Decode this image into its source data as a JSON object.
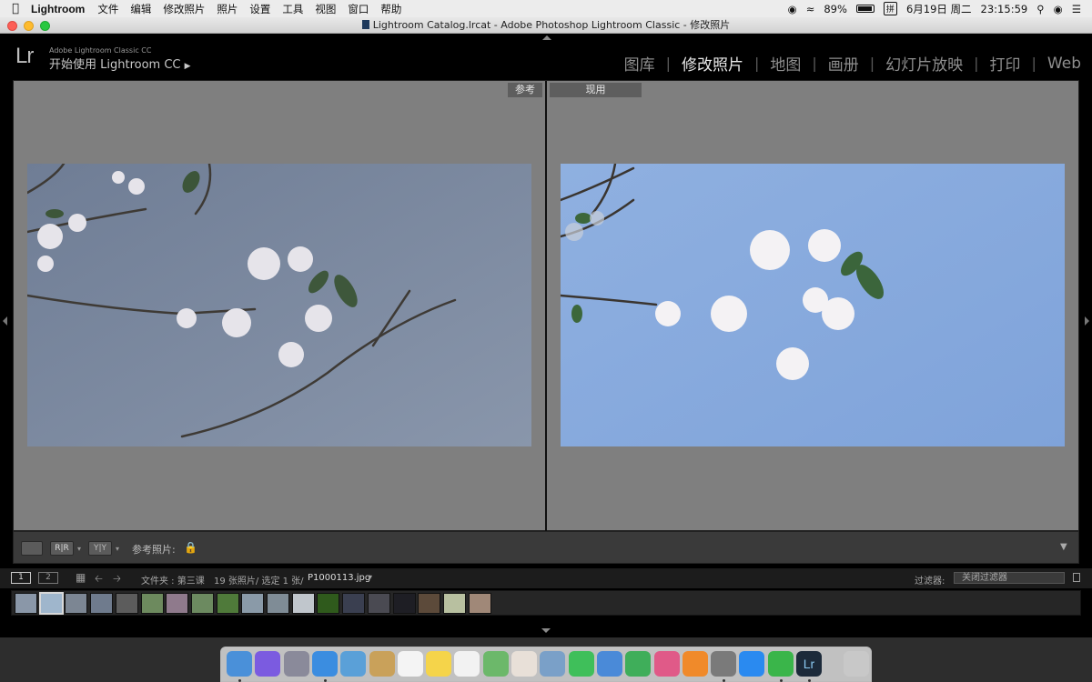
{
  "menubar": {
    "app": "Lightroom",
    "items": [
      "文件",
      "编辑",
      "修改照片",
      "照片",
      "设置",
      "工具",
      "视图",
      "窗口",
      "帮助"
    ],
    "battery": "89%",
    "ime": "拼",
    "date": "6月19日 周二",
    "time": "23:15:59"
  },
  "window": {
    "title": "Lightroom Catalog.lrcat - Adobe Photoshop Lightroom Classic - 修改照片"
  },
  "lr": {
    "logo": "Lr",
    "subtitle": "Adobe Lightroom Classic CC",
    "start": "开始使用 Lightroom CC",
    "modules": [
      "图库",
      "修改照片",
      "地图",
      "画册",
      "幻灯片放映",
      "打印",
      "Web"
    ],
    "active_module_index": 1
  },
  "compare": {
    "reference_tag": "参考",
    "active_tag": "现用"
  },
  "toolbar": {
    "reference_label": "参考照片:"
  },
  "filmbar": {
    "page1": "1",
    "page2": "2",
    "source_label": "文件夹 : 第三课",
    "count": "19 张照片/ 选定 1 张/",
    "filename": "P1000113.jpg",
    "filter_label": "过滤器:",
    "filter_value": "关闭过滤器"
  },
  "filmstrip": {
    "colors": [
      "#8a97a8",
      "#9fb6cc",
      "#7c8693",
      "#6f7b8d",
      "#5c5c5c",
      "#6d8a5e",
      "#8f7a8c",
      "#6c8a60",
      "#4f7a3a",
      "#8a9aa8",
      "#7f8c96",
      "#c0c6cc",
      "#2f5a1c",
      "#3a3f50",
      "#4a4a52",
      "#1e1e24",
      "#5c4a3a",
      "#b8c0a0",
      "#a08878"
    ],
    "selected_index": 1
  },
  "dock": {
    "icons": [
      "finder-icon",
      "siri-icon",
      "launchpad-icon",
      "safari-icon",
      "mail-icon",
      "notes-icon",
      "calendar-icon",
      "stickies-icon",
      "reminders-icon",
      "maps-icon",
      "photos-icon",
      "preview-icon",
      "facetime-icon",
      "keynote-icon",
      "numbers-icon",
      "itunes-icon",
      "books-icon",
      "system-prefs-icon",
      "appstore-icon",
      "wechat-icon",
      "lightroom-icon",
      "trash-icon"
    ]
  }
}
